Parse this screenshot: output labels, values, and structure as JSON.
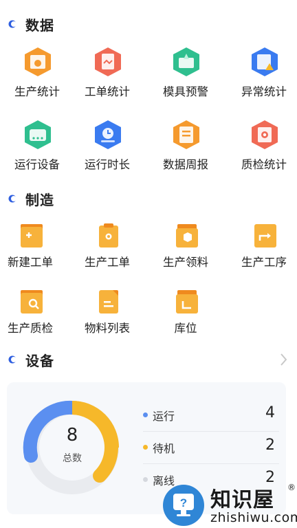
{
  "sections": {
    "data": {
      "title": "数据",
      "items": [
        {
          "label": "生产统计",
          "icon": "production-stats-icon",
          "color": "#f59a2e"
        },
        {
          "label": "工单统计",
          "icon": "work-order-stats-icon",
          "color": "#f06a55"
        },
        {
          "label": "模具预警",
          "icon": "mold-warning-icon",
          "color": "#2fbf8f"
        },
        {
          "label": "异常统计",
          "icon": "exception-stats-icon",
          "color": "#3a7bf0"
        },
        {
          "label": "运行设备",
          "icon": "running-equipment-icon",
          "color": "#2fbf8f"
        },
        {
          "label": "运行时长",
          "icon": "running-time-icon",
          "color": "#3a7bf0"
        },
        {
          "label": "数据周报",
          "icon": "weekly-report-icon",
          "color": "#f59a2e"
        },
        {
          "label": "质检统计",
          "icon": "quality-stats-icon",
          "color": "#f06a55"
        }
      ]
    },
    "manufacturing": {
      "title": "制造",
      "items": [
        {
          "label": "新建工单",
          "icon": "new-work-order-icon"
        },
        {
          "label": "生产工单",
          "icon": "production-order-icon"
        },
        {
          "label": "生产领料",
          "icon": "material-requisition-icon"
        },
        {
          "label": "生产工序",
          "icon": "production-process-icon"
        },
        {
          "label": "生产质检",
          "icon": "quality-inspection-icon"
        },
        {
          "label": "物料列表",
          "icon": "material-list-icon"
        },
        {
          "label": "库位",
          "icon": "storage-location-icon"
        }
      ]
    },
    "equipment": {
      "title": "设备",
      "total": "8",
      "total_label": "总数",
      "statuses": [
        {
          "label": "运行",
          "value": "4",
          "color": "#5b8ff0"
        },
        {
          "label": "待机",
          "value": "2",
          "color": "#f6b82a"
        },
        {
          "label": "离线",
          "value": "2",
          "color": "#d5d8de"
        }
      ]
    }
  },
  "watermark": {
    "brand": "知识屋",
    "domain": "zhishiwu.com",
    "mark": "®"
  },
  "colors": {
    "accent_blue": "#3a7bf0",
    "folder_orange": "#f7b23b",
    "folder_dark": "#ef8a1e"
  }
}
